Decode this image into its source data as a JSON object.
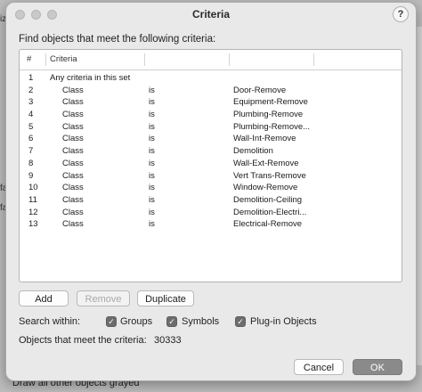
{
  "background": {
    "left_fragment_1": "iz",
    "left_fragment_2": "fa",
    "left_fragment_3": "fa",
    "bottom_text": "Draw all other objects grayed"
  },
  "dialog": {
    "title": "Criteria",
    "help_label": "?",
    "prompt": "Find objects that meet the following criteria:",
    "table": {
      "headers": [
        "#",
        "Criteria",
        "",
        "",
        ""
      ],
      "rows": [
        {
          "num": "1",
          "field": "Any criteria in this set",
          "op": "",
          "value": ""
        },
        {
          "num": "2",
          "field": "Class",
          "op": "is",
          "value": "Door-Remove"
        },
        {
          "num": "3",
          "field": "Class",
          "op": "is",
          "value": "Equipment-Remove"
        },
        {
          "num": "4",
          "field": "Class",
          "op": "is",
          "value": "Plumbing-Remove"
        },
        {
          "num": "5",
          "field": "Class",
          "op": "is",
          "value": "Plumbing-Remove..."
        },
        {
          "num": "6",
          "field": "Class",
          "op": "is",
          "value": "Wall-Int-Remove"
        },
        {
          "num": "7",
          "field": "Class",
          "op": "is",
          "value": "Demolition"
        },
        {
          "num": "8",
          "field": "Class",
          "op": "is",
          "value": "Wall-Ext-Remove"
        },
        {
          "num": "9",
          "field": "Class",
          "op": "is",
          "value": "Vert Trans-Remove"
        },
        {
          "num": "10",
          "field": "Class",
          "op": "is",
          "value": "Window-Remove"
        },
        {
          "num": "11",
          "field": "Class",
          "op": "is",
          "value": "Demolition-Ceiling"
        },
        {
          "num": "12",
          "field": "Class",
          "op": "is",
          "value": "Demolition-Electri..."
        },
        {
          "num": "13",
          "field": "Class",
          "op": "is",
          "value": "Electrical-Remove"
        }
      ]
    },
    "buttons": {
      "add": "Add",
      "remove": "Remove",
      "duplicate": "Duplicate",
      "cancel": "Cancel",
      "ok": "OK"
    },
    "search_within": {
      "label": "Search within:",
      "options": [
        {
          "label": "Groups",
          "checked": true
        },
        {
          "label": "Symbols",
          "checked": true
        },
        {
          "label": "Plug-in Objects",
          "checked": true
        }
      ]
    },
    "result_label": "Objects that meet the criteria:",
    "result_count": "30333"
  }
}
